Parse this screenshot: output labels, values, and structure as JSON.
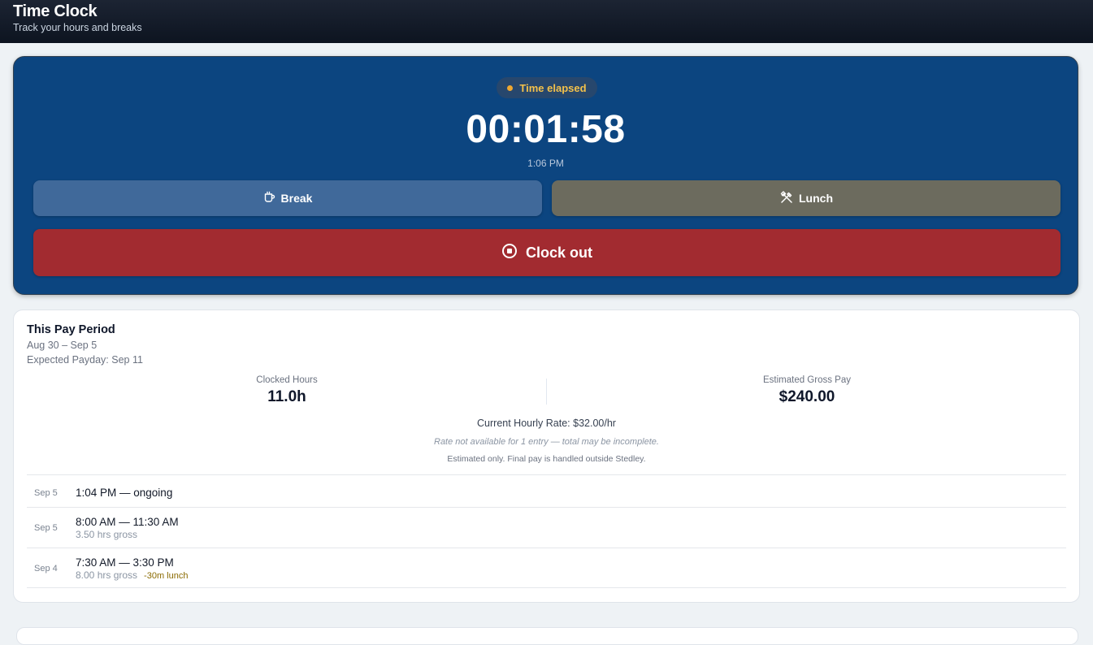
{
  "header": {
    "title": "Time Clock",
    "subtitle": "Track your hours and breaks"
  },
  "clock": {
    "status_label": "Time elapsed",
    "elapsed": "00:01:58",
    "clock_in_time": "1:06 PM",
    "break_label": "Break",
    "lunch_label": "Lunch",
    "clock_out_label": "Clock out"
  },
  "pay_period": {
    "title": "This Pay Period",
    "dates": "Aug 30 – Sep 5",
    "payday": "Expected Payday: Sep 11",
    "clocked_hours_label": "Clocked Hours",
    "clocked_hours_value": "11.0h",
    "gross_pay_label": "Estimated Gross Pay",
    "gross_pay_value": "$240.00",
    "hourly_rate": "Current Hourly Rate: $32.00/hr",
    "rate_note": "Rate not available for 1 entry — total may be incomplete.",
    "estimate_note": "Estimated only. Final pay is handled outside Stedley."
  },
  "entries": [
    {
      "date": "Sep 5",
      "range": "1:04 PM — ongoing"
    },
    {
      "date": "Sep 5",
      "range": "8:00 AM — 11:30 AM",
      "gross": "3.50 hrs gross"
    },
    {
      "date": "Sep 4",
      "range": "7:30 AM — 3:30 PM",
      "gross": "8.00 hrs gross",
      "lunch": "-30m lunch"
    }
  ],
  "colors": {
    "clock_card_bg": "#0c4580",
    "status_accent": "#f0a830",
    "break_button": "#40699a",
    "lunch_button": "#6c6b5e",
    "clock_out_button": "#a22b30"
  },
  "icons": {
    "status": "dot-icon",
    "break": "coffee-cup-icon",
    "lunch": "utensils-icon",
    "clock_out": "stop-circle-icon"
  }
}
